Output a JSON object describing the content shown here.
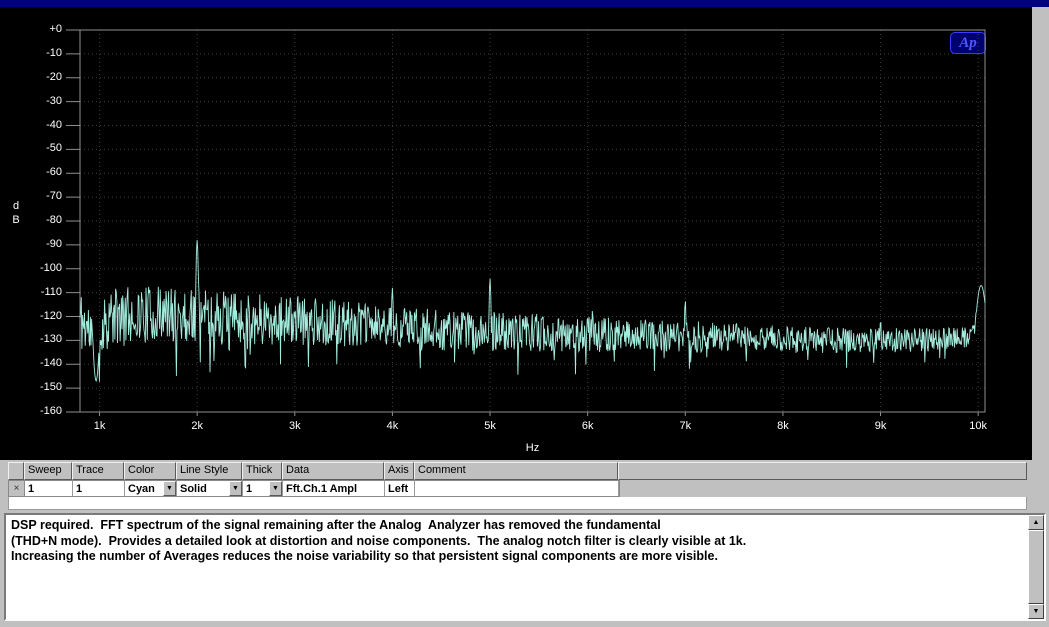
{
  "window": {
    "bg": "#c0c0c0",
    "titlebar_color": "#000085"
  },
  "logo": {
    "text": "Ap",
    "color": "#4a5aff",
    "bg": "#000070"
  },
  "plot": {
    "bg": "#000000",
    "trace_color": "#a4ecdd",
    "grid_color": "#3e3e3e",
    "frame_color": "#909090",
    "text_color": "#ffffff",
    "x_unit": "Hz",
    "y_unit_chars": [
      "d",
      "B"
    ]
  },
  "chart_data": {
    "type": "line",
    "series": [
      {
        "name": "Fft.Ch.1 Ampl",
        "color_name": "Cyan",
        "axis": "Left"
      }
    ],
    "xlabel": "Hz",
    "ylabel": "dB",
    "x_ticks": [
      "1k",
      "2k",
      "3k",
      "4k",
      "5k",
      "6k",
      "7k",
      "8k",
      "9k",
      "10k"
    ],
    "x_tick_hz": [
      1000,
      2000,
      3000,
      4000,
      5000,
      6000,
      7000,
      8000,
      9000,
      10000
    ],
    "y_ticks": [
      "+0",
      "-10",
      "-20",
      "-30",
      "-40",
      "-50",
      "-60",
      "-70",
      "-80",
      "-90",
      "-100",
      "-110",
      "-120",
      "-130",
      "-140",
      "-150",
      "-160"
    ],
    "x_range_hz": [
      800,
      10070
    ],
    "y_range_db": [
      0,
      -160
    ],
    "grid": true,
    "noise_floor_db": [
      [
        800,
        -121,
        14
      ],
      [
        900,
        -126,
        13
      ],
      [
        980,
        -131,
        12
      ],
      [
        1060,
        -121,
        13
      ],
      [
        1400,
        -119,
        12
      ],
      [
        2000,
        -120,
        12
      ],
      [
        2600,
        -121,
        11
      ],
      [
        3200,
        -122,
        10
      ],
      [
        3900,
        -124,
        9
      ],
      [
        4700,
        -126,
        8.5
      ],
      [
        5600,
        -127,
        8
      ],
      [
        6600,
        -128,
        7
      ],
      [
        7600,
        -129,
        6
      ],
      [
        8600,
        -130,
        5.5
      ],
      [
        9400,
        -130,
        5
      ],
      [
        9900,
        -128,
        5
      ],
      [
        10070,
        -116,
        4
      ]
    ],
    "peaks_db": [
      [
        2000,
        -88,
        10
      ],
      [
        4000,
        -108,
        9
      ],
      [
        5000,
        -104,
        9
      ],
      [
        6050,
        -117,
        8
      ],
      [
        7000,
        -113,
        8
      ],
      [
        9000,
        -121,
        8
      ],
      [
        10030,
        -107,
        45
      ]
    ],
    "dips_db": [
      [
        965,
        -147,
        25
      ]
    ],
    "noise_seed": 11,
    "points": 1400
  },
  "table": {
    "headers": [
      "Sweep",
      "Trace",
      "Color",
      "Line Style",
      "Thick",
      "Data",
      "Axis",
      "Comment"
    ],
    "row": {
      "sweep": "1",
      "trace": "1",
      "color": "Cyan",
      "line_style": "Solid",
      "thick": "1",
      "data": "Fft.Ch.1 Ampl",
      "axis": "Left",
      "comment": ""
    }
  },
  "icons": {
    "dropdown": "▼",
    "scroll_up": "▲",
    "scroll_down": "▼",
    "row_handle": "×"
  },
  "comment_box": {
    "text": "DSP required.  FFT spectrum of the signal remaining after the Analog  Analyzer has removed the fundamental\n(THD+N mode).  Provides a detailed look at distortion and noise components.  The analog notch filter is clearly visible at 1k.\nIncreasing the number of Averages reduces the noise variability so that persistent signal components are more visible."
  }
}
